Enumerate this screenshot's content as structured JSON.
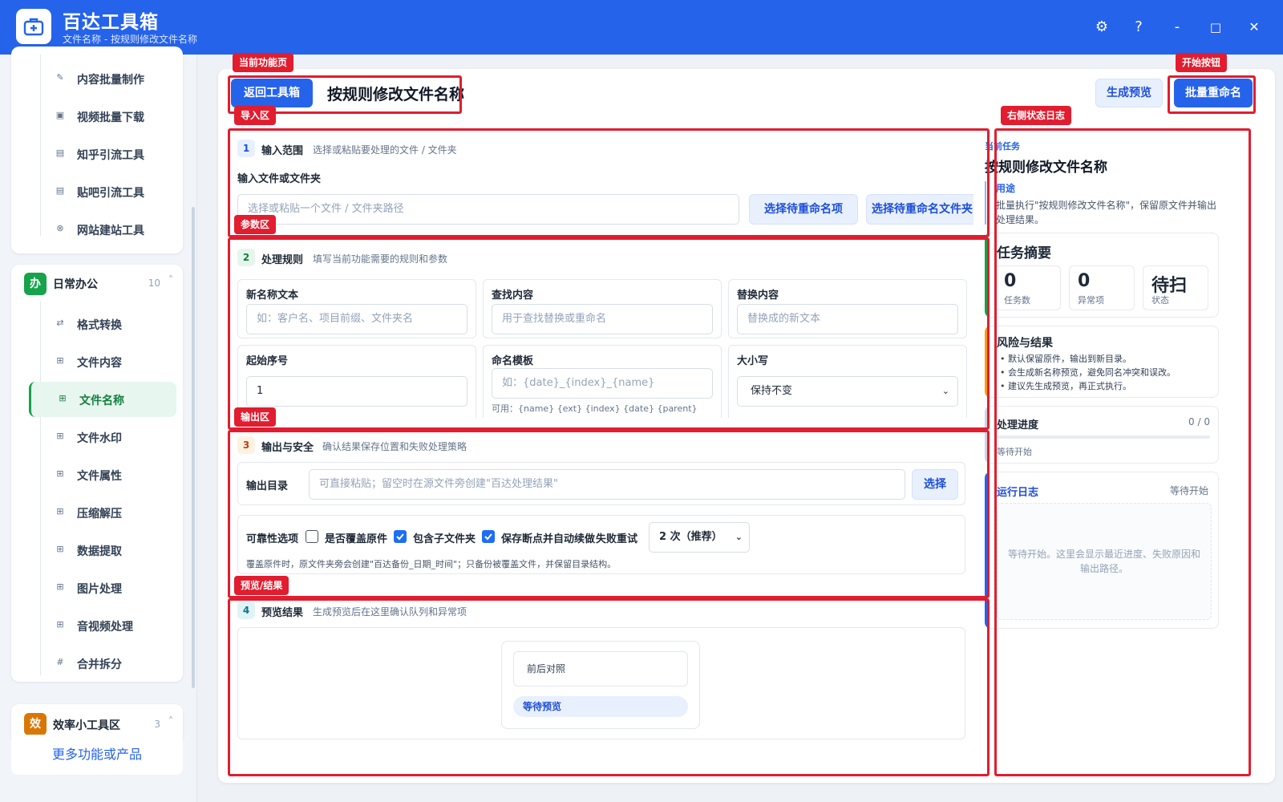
{
  "app": {
    "title": "百达工具箱",
    "subtitle": "文件名称 - 按规则修改文件名称"
  },
  "window_controls": {
    "settings": "⚙",
    "help": "?",
    "minimize": "-",
    "maximize": "□",
    "close": "✕"
  },
  "sidebar": {
    "content_items": [
      {
        "label": "内容批量制作",
        "icon": "edit-icon",
        "glyph": "✎"
      },
      {
        "label": "视频批量下载",
        "icon": "video-icon",
        "glyph": "▣"
      },
      {
        "label": "知乎引流工具",
        "icon": "zhihu-icon",
        "glyph": "▤"
      },
      {
        "label": "贴吧引流工具",
        "icon": "tieba-icon",
        "glyph": "▤"
      },
      {
        "label": "网站建站工具",
        "icon": "globe-icon",
        "glyph": "⊗"
      }
    ],
    "office_group": {
      "badge": "办",
      "title": "日常办公",
      "count": "10",
      "caret": "˄",
      "color": "#16a34a",
      "items": [
        {
          "label": "格式转换",
          "icon": "swap-icon",
          "glyph": "⇄"
        },
        {
          "label": "文件内容",
          "icon": "grid-icon",
          "glyph": "⊞"
        },
        {
          "label": "文件名称",
          "icon": "grid-icon",
          "glyph": "⊞"
        },
        {
          "label": "文件水印",
          "icon": "grid-icon",
          "glyph": "⊞"
        },
        {
          "label": "文件属性",
          "icon": "grid-icon",
          "glyph": "⊞"
        },
        {
          "label": "压缩解压",
          "icon": "grid-icon",
          "glyph": "⊞"
        },
        {
          "label": "数据提取",
          "icon": "grid-icon",
          "glyph": "⊞"
        },
        {
          "label": "图片处理",
          "icon": "grid-icon",
          "glyph": "⊞"
        },
        {
          "label": "音视频处理",
          "icon": "grid-icon",
          "glyph": "⊞"
        },
        {
          "label": "合并拆分",
          "icon": "hash-icon",
          "glyph": "#"
        }
      ],
      "active_index": 2
    },
    "efficiency_group": {
      "badge": "效",
      "title": "效率小工具区",
      "count": "3",
      "caret": "˄",
      "color": "#d97706"
    },
    "more": "更多功能或产品"
  },
  "annotations": {
    "current_page": "当前功能页",
    "start_button": "开始按钮",
    "import_area": "导入区",
    "log_area": "右侧状态日志",
    "param_area": "参数区",
    "output_area": "输出区",
    "preview_area": "预览/结果"
  },
  "header": {
    "back_button": "返回工具箱",
    "page_title": "按规则修改文件名称",
    "preview_button": "生成预览",
    "run_button": "批量重命名"
  },
  "step1": {
    "num": "1",
    "title": "输入范围",
    "desc": "选择或粘贴要处理的文件 / 文件夹",
    "field_label": "输入文件或文件夹",
    "placeholder": "选择或粘贴一个文件 / 文件夹路径",
    "pick_files": "选择待重命名项",
    "pick_folder": "选择待重命名文件夹"
  },
  "step2": {
    "num": "2",
    "title": "处理规则",
    "desc": "填写当前功能需要的规则和参数",
    "fields": {
      "new_name": {
        "label": "新名称文本",
        "placeholder": "如：客户名、项目前缀、文件夹名"
      },
      "find": {
        "label": "查找内容",
        "placeholder": "用于查找替换或重命名"
      },
      "replace": {
        "label": "替换内容",
        "placeholder": "替换成的新文本"
      },
      "start_index": {
        "label": "起始序号",
        "value": "1"
      },
      "template": {
        "label": "命名模板",
        "placeholder": "如：{date}_{index}_{name}",
        "hint": "可用：{name} {ext} {index} {date} {parent}"
      },
      "case": {
        "label": "大小写",
        "value": "保持不变"
      }
    }
  },
  "step3": {
    "num": "3",
    "title": "输出与安全",
    "desc": "确认结果保存位置和失败处理策略",
    "output_label": "输出目录",
    "output_placeholder": "可直接粘贴；留空时在源文件旁创建\"百达处理结果\"",
    "choose": "选择",
    "reliability_label": "可靠性选项",
    "overwrite": {
      "label": "是否覆盖原件",
      "checked": false
    },
    "subfolders": {
      "label": "包含子文件夹",
      "checked": true
    },
    "resume": {
      "label": "保存断点并自动续做",
      "checked": true
    },
    "retry_label": "失败重试",
    "retry_value": "2 次（推荐）",
    "note": "覆盖原件时，原文件夹旁会创建\"百达备份_日期_时间\"；只备份被覆盖文件，并保留目录结构。"
  },
  "step4": {
    "num": "4",
    "title": "预览结果",
    "desc": "生成预览后在这里确认队列和异常项",
    "compare": "前后对照",
    "waiting": "等待预览"
  },
  "right_panel": {
    "task_label": "当前任务",
    "task_title": "按规则修改文件名称",
    "purpose_label": "用途",
    "purpose_text": "批量执行\"按规则修改文件名称\"，保留原文件并输出处理结果。",
    "summary": {
      "title": "任务摘要",
      "stats": [
        {
          "value": "0",
          "key": "任务数"
        },
        {
          "value": "0",
          "key": "异常项"
        },
        {
          "value": "待扫",
          "key": "状态"
        }
      ]
    },
    "risk": {
      "title": "风险与结果",
      "items": [
        "默认保留原件，输出到新目录。",
        "会生成新名称预览，避免同名冲突和误改。",
        "建议先生成预览，再正式执行。"
      ]
    },
    "progress": {
      "title": "处理进度",
      "count": "0 / 0",
      "fraction": 0,
      "status": "等待开始"
    },
    "log": {
      "title": "运行日志",
      "status": "等待开始",
      "placeholder": "等待开始。这里会显示最近进度、失败原因和输出路径。"
    }
  },
  "colors": {
    "primary": "#2563eb",
    "annotation": "#e11d2f",
    "office": "#16a34a",
    "efficiency": "#d97706"
  }
}
